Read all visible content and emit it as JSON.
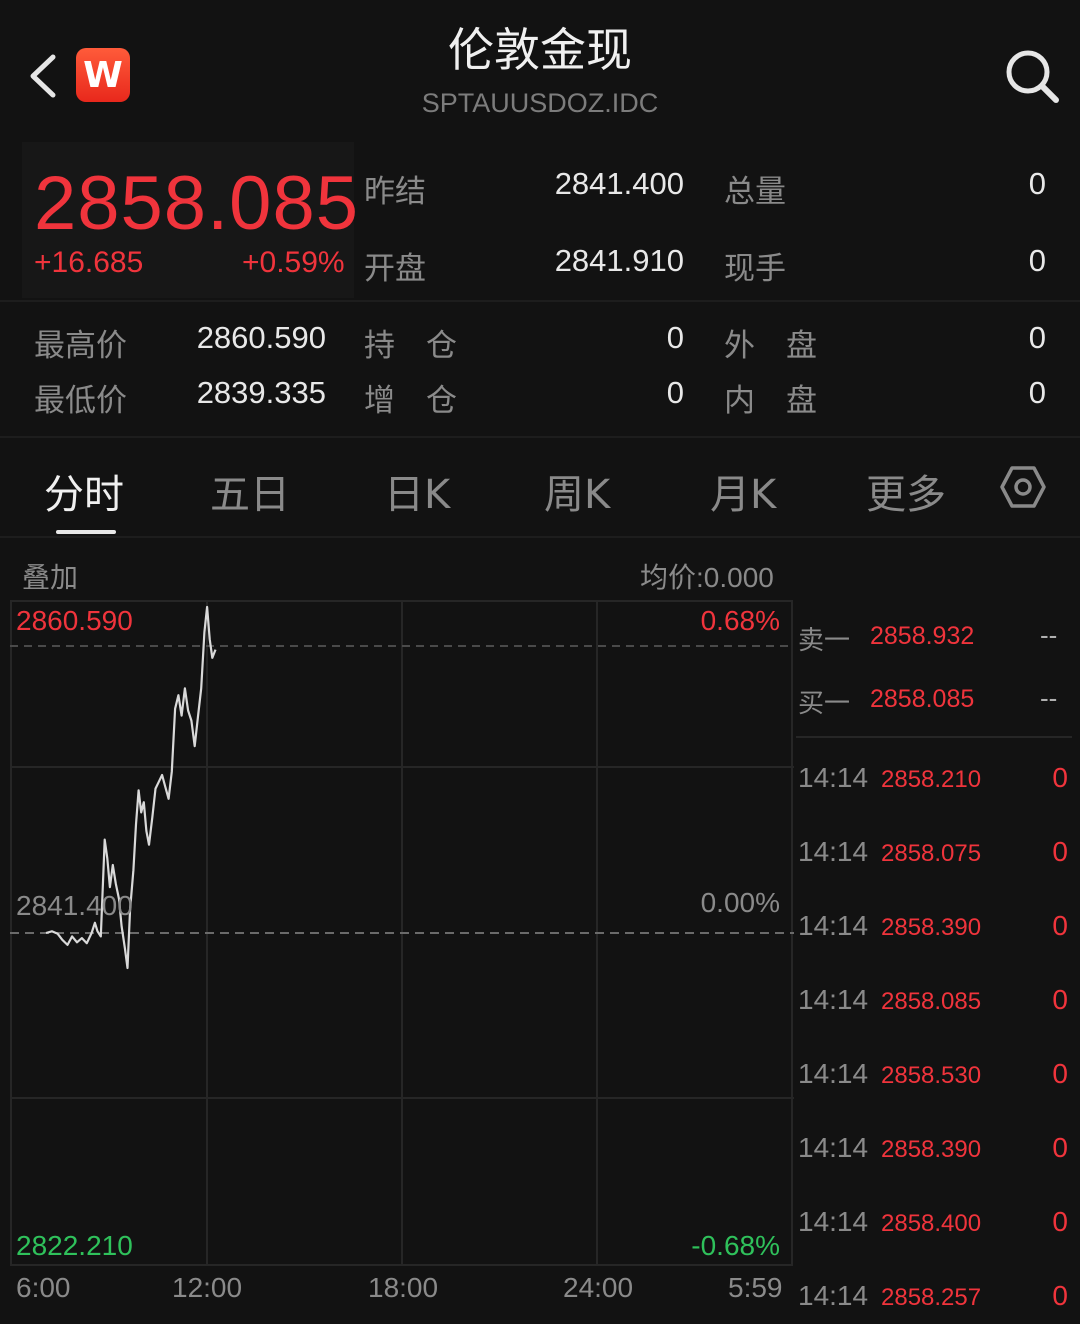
{
  "header": {
    "title": "伦敦金现",
    "subtitle": "SPTAUUSDOZ.IDC",
    "logo_letter": "W",
    "back_icon": "chevron-left-icon",
    "search_icon": "search-icon"
  },
  "quote": {
    "price": "2858.085",
    "change": "+16.685",
    "change_pct": "+0.59%",
    "stats": [
      {
        "label": "昨结",
        "value": "2841.400"
      },
      {
        "label": "总量",
        "value": "0"
      },
      {
        "label": "开盘",
        "value": "2841.910"
      },
      {
        "label": "现手",
        "value": "0"
      },
      {
        "label": "最高价",
        "value": "2860.590"
      },
      {
        "label": "持　仓",
        "value": "0"
      },
      {
        "label": "外　盘",
        "value": "0"
      },
      {
        "label": "最低价",
        "value": "2839.335"
      },
      {
        "label": "增　仓",
        "value": "0"
      },
      {
        "label": "内　盘",
        "value": "0"
      }
    ]
  },
  "tabs": [
    {
      "label": "分时",
      "active": true
    },
    {
      "label": "五日"
    },
    {
      "label": "日K"
    },
    {
      "label": "周K"
    },
    {
      "label": "月K"
    },
    {
      "label": "更多"
    }
  ],
  "settings_icon": "hexagon-settings-icon",
  "chart_header": {
    "overlay_label": "叠加",
    "avg_price": "均价:0.000"
  },
  "chart_data": {
    "type": "line",
    "y_labels_left": {
      "top": "2860.590",
      "mid": "2841.400",
      "bottom": "2822.210"
    },
    "y_labels_right": {
      "top": "0.68%",
      "mid": "0.00%",
      "bottom": "-0.68%"
    },
    "x_labels": [
      "6:00",
      "12:00",
      "18:00",
      "24:00",
      "5:59"
    ],
    "ylim": [
      2822.21,
      2860.59
    ],
    "baseline": 2841.4,
    "session_hours": 24,
    "series": [
      {
        "points": [
          [
            0.0,
            2841.4
          ],
          [
            0.18,
            2841.5
          ],
          [
            0.36,
            2841.35
          ],
          [
            0.5,
            2841.0
          ],
          [
            0.66,
            2840.7
          ],
          [
            0.8,
            2841.2
          ],
          [
            0.95,
            2840.85
          ],
          [
            1.1,
            2841.1
          ],
          [
            1.25,
            2840.8
          ],
          [
            1.4,
            2841.4
          ],
          [
            1.5,
            2842.0
          ],
          [
            1.58,
            2841.5
          ],
          [
            1.68,
            2841.2
          ],
          [
            1.8,
            2846.9
          ],
          [
            1.88,
            2845.8
          ],
          [
            1.96,
            2844.1
          ],
          [
            2.05,
            2845.4
          ],
          [
            2.14,
            2844.3
          ],
          [
            2.24,
            2843.4
          ],
          [
            2.32,
            2841.8
          ],
          [
            2.42,
            2840.5
          ],
          [
            2.5,
            2839.34
          ],
          [
            2.58,
            2842.8
          ],
          [
            2.68,
            2845.1
          ],
          [
            2.76,
            2847.8
          ],
          [
            2.84,
            2849.8
          ],
          [
            2.92,
            2848.5
          ],
          [
            3.0,
            2849.1
          ],
          [
            3.08,
            2847.4
          ],
          [
            3.16,
            2846.6
          ],
          [
            3.26,
            2848.2
          ],
          [
            3.36,
            2849.9
          ],
          [
            3.46,
            2850.3
          ],
          [
            3.56,
            2850.7
          ],
          [
            3.66,
            2850.0
          ],
          [
            3.76,
            2849.3
          ],
          [
            3.86,
            2850.9
          ],
          [
            3.96,
            2854.6
          ],
          [
            4.06,
            2855.4
          ],
          [
            4.16,
            2854.2
          ],
          [
            4.26,
            2855.8
          ],
          [
            4.36,
            2854.5
          ],
          [
            4.46,
            2853.9
          ],
          [
            4.56,
            2852.4
          ],
          [
            4.66,
            2854.1
          ],
          [
            4.76,
            2855.8
          ],
          [
            4.86,
            2859.1
          ],
          [
            4.94,
            2860.59
          ],
          [
            5.02,
            2858.7
          ],
          [
            5.1,
            2857.6
          ],
          [
            5.2,
            2858.085
          ]
        ]
      }
    ]
  },
  "order_book": {
    "asks": [
      {
        "label": "卖一",
        "price": "2858.932",
        "volume": "--"
      }
    ],
    "bids": [
      {
        "label": "买一",
        "price": "2858.085",
        "volume": "--"
      }
    ]
  },
  "trades": [
    {
      "time": "14:14",
      "price": "2858.210",
      "volume": "0"
    },
    {
      "time": "14:14",
      "price": "2858.075",
      "volume": "0"
    },
    {
      "time": "14:14",
      "price": "2858.390",
      "volume": "0"
    },
    {
      "time": "14:14",
      "price": "2858.085",
      "volume": "0"
    },
    {
      "time": "14:14",
      "price": "2858.530",
      "volume": "0"
    },
    {
      "time": "14:14",
      "price": "2858.390",
      "volume": "0"
    },
    {
      "time": "14:14",
      "price": "2858.400",
      "volume": "0"
    },
    {
      "time": "14:14",
      "price": "2858.257",
      "volume": "0"
    }
  ],
  "colors": {
    "up": "#f0343c",
    "down": "#2fc15b",
    "line": "#d9d9d9",
    "background": "#121212"
  }
}
